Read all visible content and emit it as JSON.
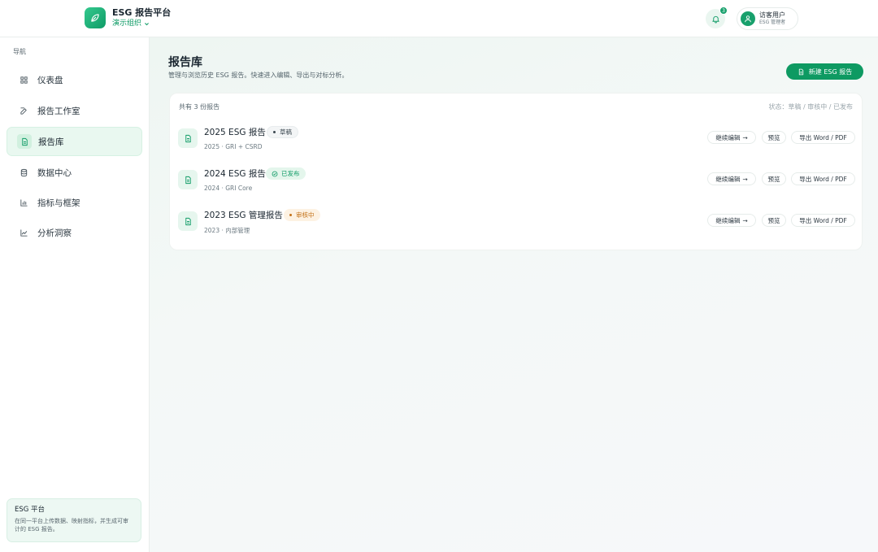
{
  "header": {
    "title": "ESG 报告平台",
    "org": "演示组织",
    "notification_count": "3",
    "user_name": "访客用户",
    "user_role": "ESG 管理者"
  },
  "sidebar": {
    "nav_title": "导航",
    "items": [
      {
        "label": "仪表盘",
        "icon": "grid-icon"
      },
      {
        "label": "报告工作室",
        "icon": "edit-icon"
      },
      {
        "label": "报告库",
        "icon": "document-icon",
        "active": true
      },
      {
        "label": "数据中心",
        "icon": "database-icon"
      },
      {
        "label": "指标与框架",
        "icon": "bar-chart-icon"
      },
      {
        "label": "分析洞察",
        "icon": "line-chart-icon"
      }
    ],
    "card": {
      "title": "ESG 平台",
      "desc": "在同一平台上传数据、映射指标，并生成可审计的 ESG 报告。"
    }
  },
  "main": {
    "title": "报告库",
    "subtitle": "管理与浏览历史 ESG 报告。快速进入编辑、导出与对标分析。",
    "new_button": "新建 ESG 报告",
    "count_text": "共有 3 份报告",
    "status_legend": "状态：草稿 / 审核中 / 已发布",
    "reports": [
      {
        "title": "2025 ESG 报告",
        "status": "草稿",
        "status_type": "draft",
        "meta": "2025 · GRI + CSRD"
      },
      {
        "title": "2024 ESG 报告",
        "status": "已发布",
        "status_type": "published",
        "meta": "2024 · GRI Core"
      },
      {
        "title": "2023 ESG 管理报告",
        "status": "审核中",
        "status_type": "review",
        "meta": "2023 · 内部管理"
      }
    ],
    "actions": {
      "continue": "继续编辑",
      "preview": "预览",
      "export": "导出 Word / PDF"
    }
  },
  "colors": {
    "accent": "#0e9a62",
    "accent_light": "#e6f6ee",
    "review": "#c4731a"
  }
}
